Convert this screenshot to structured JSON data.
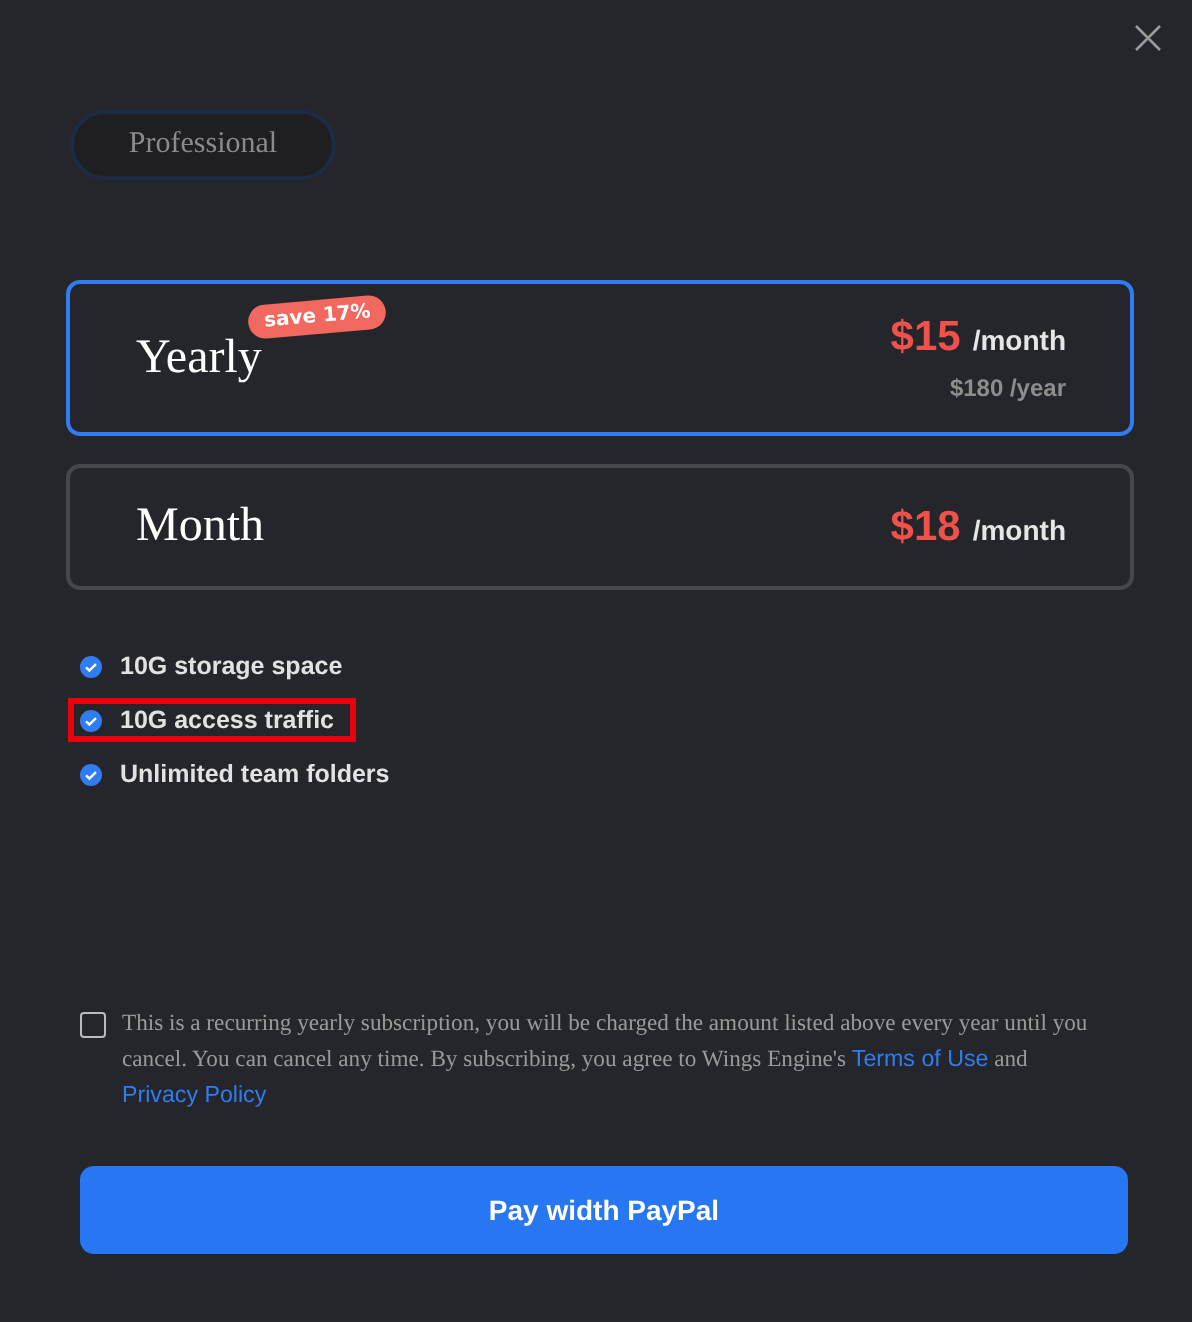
{
  "plan_name": "Professional",
  "options": [
    {
      "label": "Yearly",
      "selected": true,
      "badge": "save 17%",
      "price": "$15",
      "unit": "/month",
      "subtext": "$180 /year"
    },
    {
      "label": "Month",
      "selected": false,
      "price": "$18",
      "unit": "/month"
    }
  ],
  "features": [
    {
      "text": "10G storage space",
      "highlighted": false
    },
    {
      "text": "10G access traffic",
      "highlighted": true
    },
    {
      "text": "Unlimited team folders",
      "highlighted": false
    }
  ],
  "agreement": {
    "checked": false,
    "text_before": "This is a recurring yearly subscription, you will be charged the amount listed above every year until you cancel. You can cancel any time. By subscribing, you agree to Wings Engine's ",
    "terms_link": "Terms of Use",
    "text_middle": " and ",
    "privacy_link": "Privacy Policy"
  },
  "pay_button": "Pay width PayPal"
}
